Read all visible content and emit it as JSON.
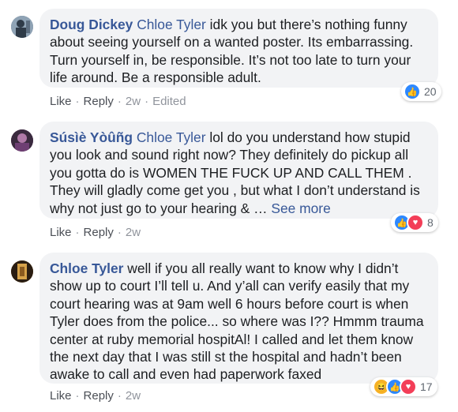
{
  "comments": [
    {
      "author": "Doug Dickey",
      "mention": "Chloe Tyler",
      "text": " idk you but there’s nothing funny about seeing yourself on a wanted poster. Its embarrassing. Turn yourself in, be responsible. It’s not too late to turn your life around. Be a responsible adult.",
      "see_more": "",
      "actions": {
        "like": "Like",
        "reply": "Reply",
        "time": "2w",
        "edited": "Edited"
      },
      "reactions": {
        "types": [
          "like"
        ],
        "count": "20"
      },
      "avatar_color": "#6b7b8c"
    },
    {
      "author": "Súsìè Yòûñg",
      "mention": "Chloe Tyler",
      "text": " lol do you understand how stupid you look and sound right now? They definitely do pickup all you gotta do is WOMEN THE FUCK UP AND CALL THEM . They will gladly come get you , but what I don’t understand is why not just go to your hearing & … ",
      "see_more": "See more",
      "actions": {
        "like": "Like",
        "reply": "Reply",
        "time": "2w",
        "edited": ""
      },
      "reactions": {
        "types": [
          "like",
          "love"
        ],
        "count": "8"
      },
      "avatar_color": "#7a4a7e"
    },
    {
      "author": "Chloe Tyler",
      "mention": "",
      "text": " well if you all really want to know why I didn’t show up to court I’ll tell u. And y’all can verify easily that my court hearing was at 9am well 6 hours before court is when Tyler does from the police... so where was I?? Hmmm trauma center at ruby memorial hospitAl! I called and let them know the next day that I was still st the hospital and hadn’t been awake to call and even had paperwork faxed",
      "see_more": "",
      "actions": {
        "like": "Like",
        "reply": "Reply",
        "time": "2w",
        "edited": ""
      },
      "reactions": {
        "types": [
          "haha",
          "like",
          "love"
        ],
        "count": "17"
      },
      "avatar_color": "#c2892e"
    }
  ]
}
